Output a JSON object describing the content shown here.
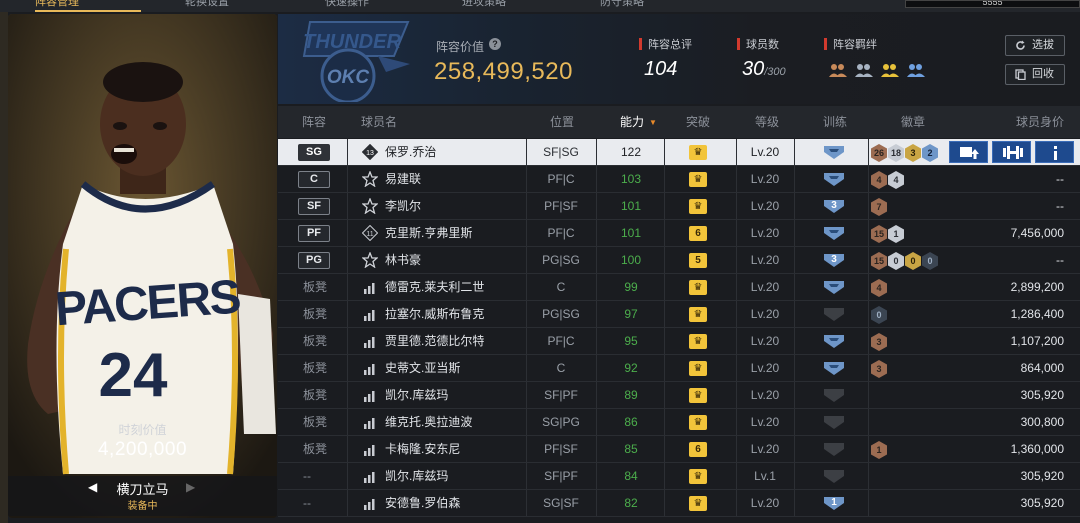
{
  "top_tabs": [
    "阵容管理",
    "轮换设置",
    "快速操作",
    "进攻策略",
    "防守策略"
  ],
  "top_search": "5555",
  "moment": {
    "label": "时刻价值",
    "value": "4,200,000",
    "skill_name": "横刀立马",
    "skill_status": "装备中"
  },
  "header": {
    "team_logo_text": "OKC",
    "value_label": "阵容价值",
    "value_help_icon": "question-icon",
    "value_number": "258,499,520",
    "rating_label": "阵容总评",
    "rating_value": "104",
    "count_label": "球员数",
    "count_value": "30",
    "count_max": "/300",
    "bond_label": "阵容羁绊",
    "bond_icons": [
      "group-icon",
      "group-icon",
      "group-icon",
      "group-icon"
    ],
    "btn_select": "选拔",
    "btn_recycle": "回收"
  },
  "columns": {
    "lineup": "阵容",
    "name": "球员名",
    "position": "位置",
    "ability": "能力",
    "breakthrough": "突破",
    "level": "等级",
    "training": "训练",
    "badges": "徽章",
    "value": "球员身价"
  },
  "colors": {
    "accent": "#e8b95a",
    "ability_green": "#4cae4c",
    "action_blue": "#1e4a8e"
  },
  "players": [
    {
      "lineup": "SG",
      "name": "保罗.乔治",
      "icon": "13",
      "position": "SF|SG",
      "ability": "122",
      "break": "",
      "level": "Lv.20",
      "train": "",
      "badges": [
        {
          "n": "26",
          "c": "bronze"
        },
        {
          "n": "18",
          "c": "silver"
        },
        {
          "n": "3",
          "c": "gold"
        },
        {
          "n": "2",
          "c": "blue"
        }
      ],
      "value": ""
    },
    {
      "lineup": "C",
      "name": "易建联",
      "icon": "star",
      "position": "PF|C",
      "ability": "103",
      "break": "",
      "level": "Lv.20",
      "train": "",
      "badges": [
        {
          "n": "4",
          "c": "bronze"
        },
        {
          "n": "4",
          "c": "silver"
        }
      ],
      "value": "--"
    },
    {
      "lineup": "SF",
      "name": "李凯尔",
      "icon": "star",
      "position": "PF|SF",
      "ability": "101",
      "break": "",
      "level": "Lv.20",
      "train": "3",
      "badges": [
        {
          "n": "7",
          "c": "bronze"
        }
      ],
      "value": "--"
    },
    {
      "lineup": "PF",
      "name": "克里斯.亨弗里斯",
      "icon": "11",
      "position": "PF|C",
      "ability": "101",
      "break": "6",
      "level": "Lv.20",
      "train": "",
      "badges": [
        {
          "n": "15",
          "c": "bronze"
        },
        {
          "n": "1",
          "c": "silver"
        }
      ],
      "value": "7,456,000"
    },
    {
      "lineup": "PG",
      "name": "林书豪",
      "icon": "star",
      "position": "PG|SG",
      "ability": "100",
      "break": "5",
      "level": "Lv.20",
      "train": "3",
      "badges": [
        {
          "n": "15",
          "c": "bronze"
        },
        {
          "n": "0",
          "c": "silver"
        },
        {
          "n": "0",
          "c": "gold"
        },
        {
          "n": "0",
          "c": "dark"
        }
      ],
      "value": "--"
    },
    {
      "lineup": "板凳",
      "name": "德雷克.莱夫利二世",
      "icon": "bars",
      "position": "C",
      "ability": "99",
      "break": "",
      "level": "Lv.20",
      "train": "",
      "badges": [
        {
          "n": "4",
          "c": "bronze"
        }
      ],
      "value": "2,899,200"
    },
    {
      "lineup": "板凳",
      "name": "拉塞尔.威斯布鲁克",
      "icon": "bars",
      "position": "PG|SG",
      "ability": "97",
      "break": "",
      "level": "Lv.20",
      "train": "-",
      "badges": [
        {
          "n": "0",
          "c": "dark"
        }
      ],
      "value": "1,286,400"
    },
    {
      "lineup": "板凳",
      "name": "贾里德.范德比尔特",
      "icon": "bars",
      "position": "PF|C",
      "ability": "95",
      "break": "",
      "level": "Lv.20",
      "train": "",
      "badges": [
        {
          "n": "3",
          "c": "bronze"
        }
      ],
      "value": "1,107,200"
    },
    {
      "lineup": "板凳",
      "name": "史蒂文.亚当斯",
      "icon": "bars",
      "position": "C",
      "ability": "92",
      "break": "",
      "level": "Lv.20",
      "train": "",
      "badges": [
        {
          "n": "3",
          "c": "bronze"
        }
      ],
      "value": "864,000"
    },
    {
      "lineup": "板凳",
      "name": "凯尔.库兹玛",
      "icon": "bars",
      "position": "SF|PF",
      "ability": "89",
      "break": "",
      "level": "Lv.20",
      "train": "-",
      "badges": [],
      "value": "305,920"
    },
    {
      "lineup": "板凳",
      "name": "维克托.奥拉迪波",
      "icon": "bars",
      "position": "SG|PG",
      "ability": "86",
      "break": "",
      "level": "Lv.20",
      "train": "-",
      "badges": [],
      "value": "300,800"
    },
    {
      "lineup": "板凳",
      "name": "卡梅隆.安东尼",
      "icon": "bars",
      "position": "PF|SF",
      "ability": "85",
      "break": "6",
      "level": "Lv.20",
      "train": "-",
      "badges": [
        {
          "n": "1",
          "c": "bronze"
        }
      ],
      "value": "1,360,000"
    },
    {
      "lineup": "--",
      "name": "凯尔.库兹玛",
      "icon": "bars",
      "position": "SF|PF",
      "ability": "84",
      "break": "",
      "level": "Lv.1",
      "train": "-",
      "badges": [],
      "value": "305,920"
    },
    {
      "lineup": "--",
      "name": "安德鲁.罗伯森",
      "icon": "bars",
      "position": "SG|SF",
      "ability": "82",
      "break": "",
      "level": "Lv.20",
      "train": "1",
      "badges": [],
      "value": "305,920"
    }
  ]
}
